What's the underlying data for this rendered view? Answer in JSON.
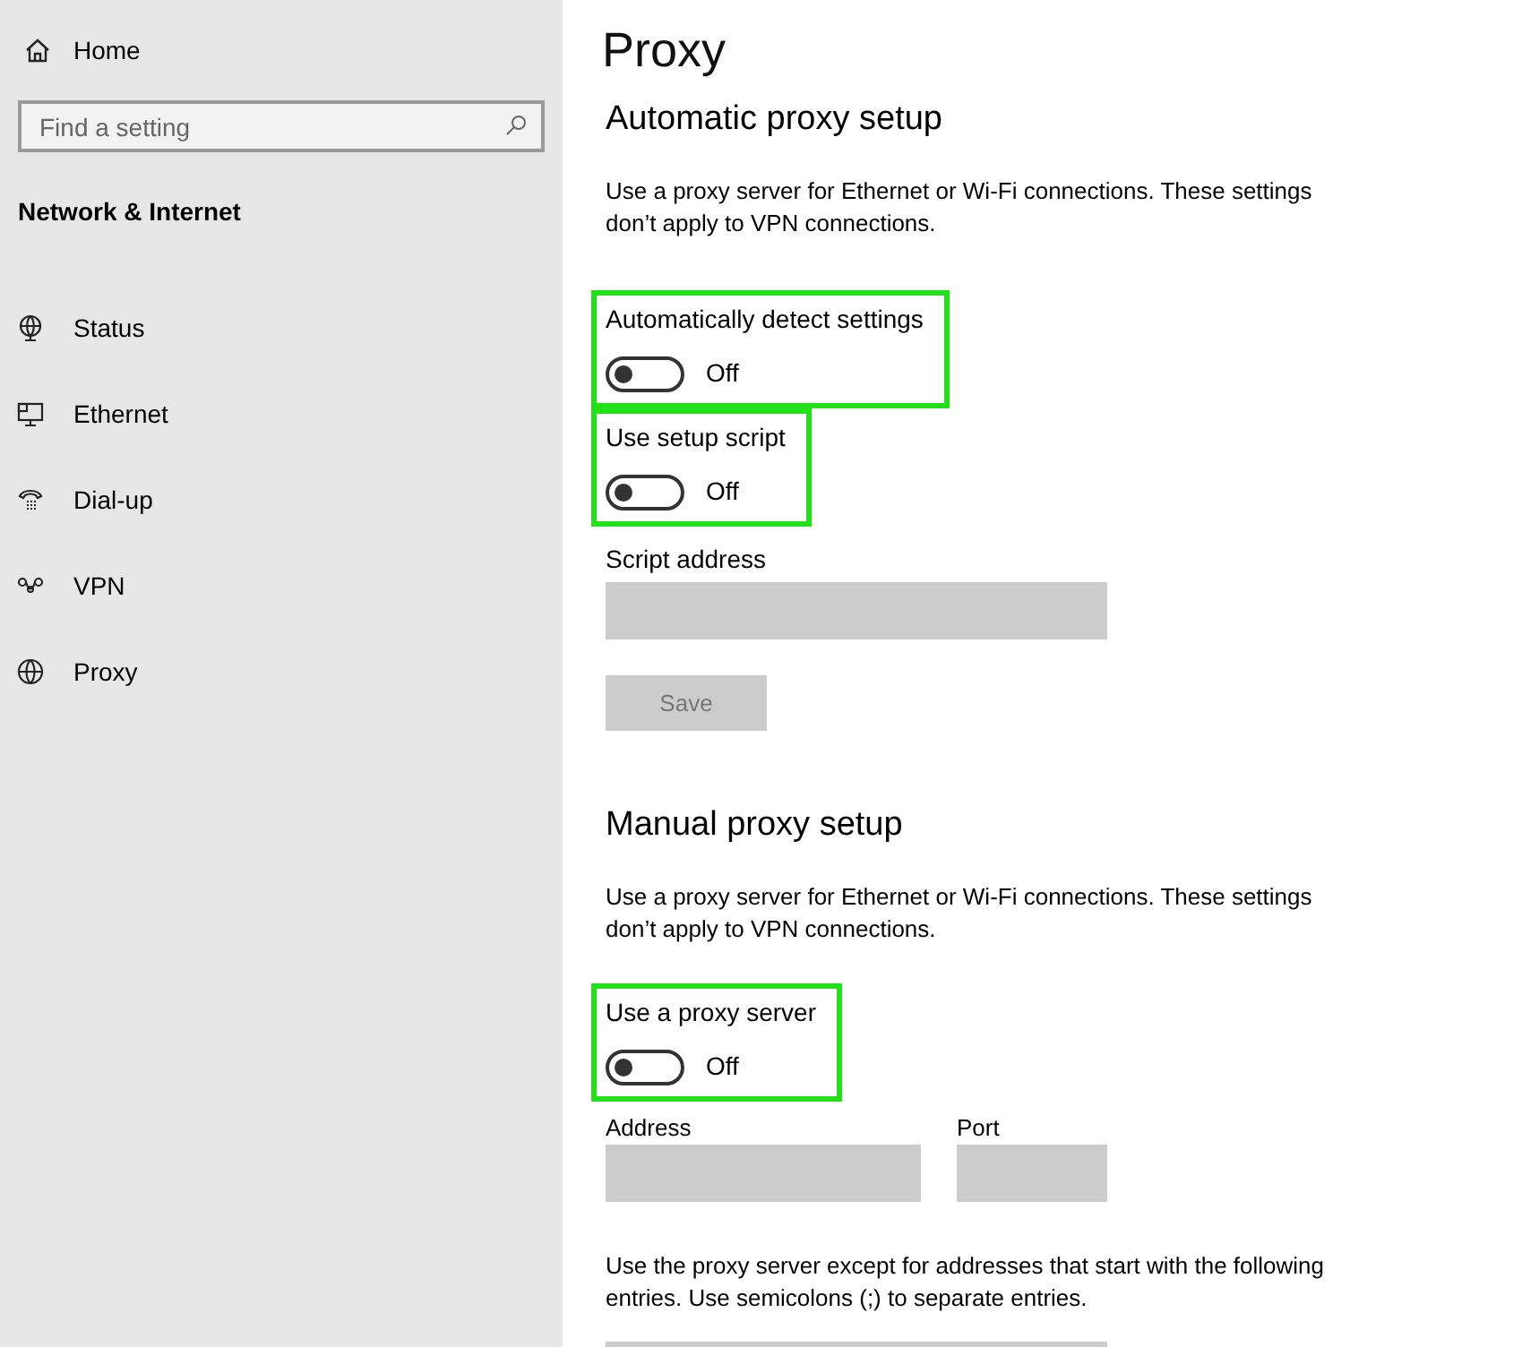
{
  "sidebar": {
    "home": "Home",
    "search": {
      "placeholder": "Find a setting"
    },
    "section_title": "Network & Internet",
    "items": [
      {
        "label": "Status",
        "kind": "status",
        "selected": false
      },
      {
        "label": "Ethernet",
        "kind": "ethernet",
        "selected": false
      },
      {
        "label": "Dial-up",
        "kind": "dialup",
        "selected": false
      },
      {
        "label": "VPN",
        "kind": "vpn",
        "selected": false
      },
      {
        "label": "Proxy",
        "kind": "proxy",
        "selected": false
      }
    ]
  },
  "page_title": "Proxy",
  "sections": [
    {
      "title": "Automatic proxy setup",
      "description": "Use a proxy server for Ethernet or Wi-Fi connections. These settings don’t apply to VPN connections.",
      "items": [
        {
          "kind": "toggle",
          "label": "Automatically detect settings",
          "on": false,
          "state_text": "Off",
          "highlighted": true
        },
        {
          "kind": "toggle",
          "label": "Use setup script",
          "on": false,
          "state_text": "Off",
          "highlighted": true
        },
        {
          "kind": "field",
          "label": "Script address",
          "disabled": true
        },
        {
          "kind": "button",
          "label": "Save",
          "disabled": true
        }
      ]
    },
    {
      "title": "Manual proxy setup",
      "description": "Use a proxy server for Ethernet or Wi-Fi connections. These settings don’t apply to VPN connections.",
      "items": [
        {
          "kind": "toggle",
          "label": "Use a proxy server",
          "on": false,
          "state_text": "Off",
          "highlighted": true
        },
        {
          "kind": "field_pair",
          "fields": [
            {
              "label": "Address",
              "disabled": true
            },
            {
              "label": "Port",
              "disabled": true
            }
          ]
        },
        {
          "kind": "note",
          "text": "Use the proxy server except for addresses that start with the following entries. Use semicolons (;) to separate entries."
        },
        {
          "kind": "wide_field",
          "disabled": true
        }
      ]
    }
  ]
}
